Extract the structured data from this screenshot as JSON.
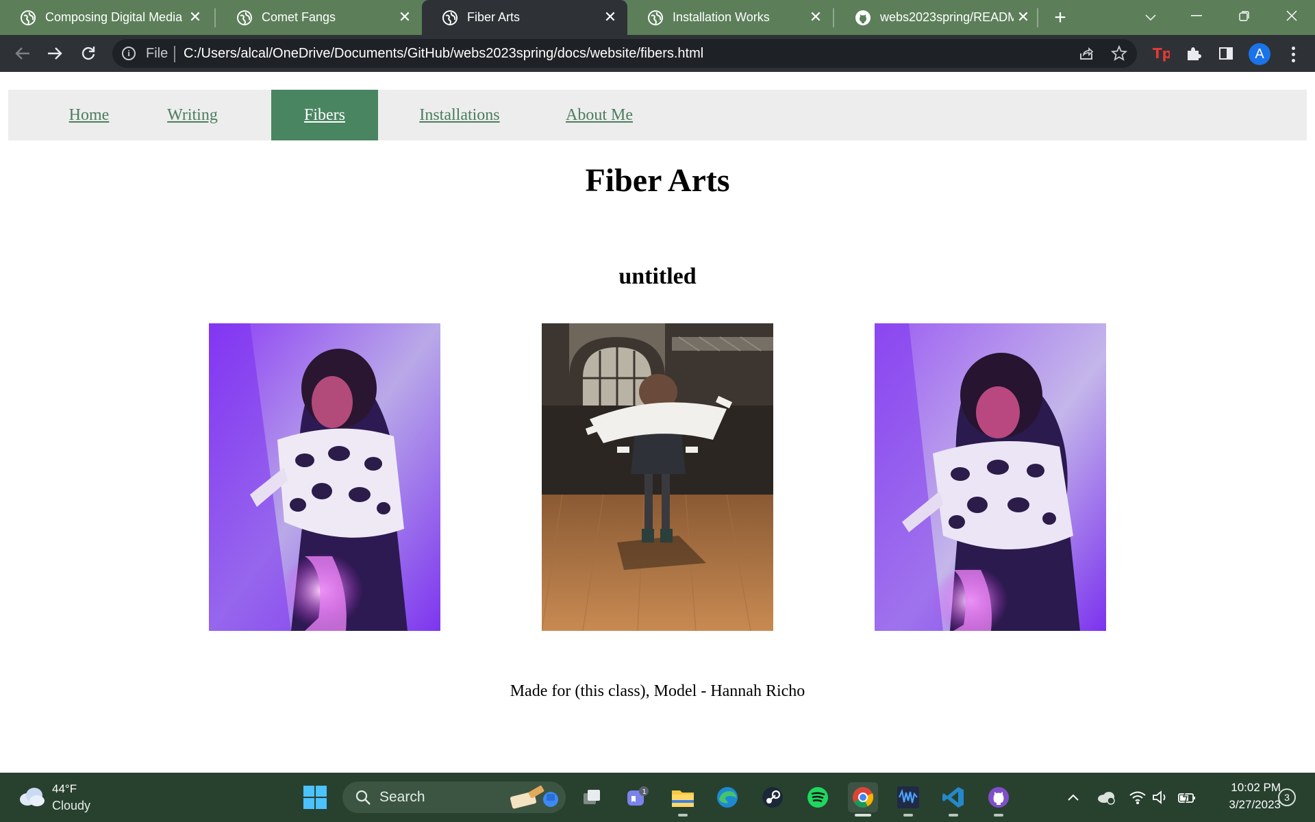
{
  "browser": {
    "tabs": [
      {
        "title": "Composing Digital Media",
        "icon": "globe-icon",
        "active": false
      },
      {
        "title": "Comet Fangs",
        "icon": "globe-icon",
        "active": false
      },
      {
        "title": "Fiber Arts",
        "icon": "globe-icon",
        "active": true
      },
      {
        "title": "Installation Works",
        "icon": "globe-icon",
        "active": false
      },
      {
        "title": "webs2023spring/README",
        "icon": "github-icon",
        "active": false
      }
    ],
    "new_tab_symbol": "+",
    "address_bar": {
      "scheme_label": "File",
      "url": "C:/Users/alcal/OneDrive/Documents/GitHub/webs2023spring/docs/website/fibers.html"
    },
    "profile_initial": "A",
    "theme_colors": {
      "tab_strip": "#5c7f5a",
      "toolbar": "#2e3236"
    }
  },
  "site": {
    "nav": [
      {
        "label": "Home",
        "active": false
      },
      {
        "label": "Writing",
        "active": false
      },
      {
        "label": "Fibers",
        "active": true
      },
      {
        "label": "Installations",
        "active": false
      },
      {
        "label": "About Me",
        "active": false
      }
    ],
    "nav_active_color": "#4a8562",
    "nav_link_color": "#4b7d5e",
    "page_title": "Fiber Arts",
    "section_title": "untitled",
    "photos": [
      {
        "subject": "model in fiber art cape, purple lighting, facing left"
      },
      {
        "subject": "model spinning in fiber art piece on wooden stage floor"
      },
      {
        "subject": "model in fiber art cape, purple lighting, eyes closed"
      }
    ],
    "caption": "Made for (this class), Model - Hannah Richo"
  },
  "taskbar": {
    "weather": {
      "temp": "44°F",
      "condition": "Cloudy",
      "icon": "cloud-icon"
    },
    "search_label": "Search",
    "apps": [
      "start-icon",
      "task-view-icon",
      "teams-icon",
      "file-explorer-icon",
      "edge-icon",
      "steam-icon",
      "spotify-icon",
      "chrome-icon",
      "waveform-app-icon",
      "vscode-icon",
      "github-desktop-icon"
    ],
    "teams_badge": "1",
    "clock": {
      "time": "10:02 PM",
      "date": "3/27/2023"
    },
    "notification_count": "3"
  }
}
